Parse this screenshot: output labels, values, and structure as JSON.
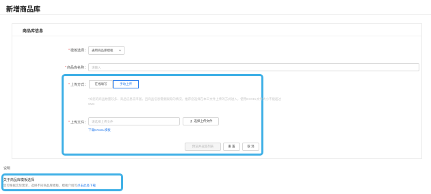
{
  "page": {
    "title": "新增商品库"
  },
  "card": {
    "title": "商品库信息"
  },
  "form": {
    "template": {
      "label": "模板选择：",
      "value": "通用商品库模板"
    },
    "name": {
      "label": "商品库名称：",
      "placeholder": "请输入"
    },
    "upload_method": {
      "label": "上传方式：",
      "options": [
        "在线填写",
        "手动上传"
      ],
      "selected": "手动上传"
    },
    "hint": "*如您的商品数量较多、商品信息较丰富，且商品信息需要跟踪的情况，推荐您选择在本工文件上传的方式进入，使用EXCEL文件大小不能超过5MB",
    "upload_file": {
      "label": "上传文件：",
      "placeholder": "请选择上传文件",
      "button": "选择上传文件",
      "download_link": "下载EXCEL模板"
    },
    "buttons": {
      "preview": "预览并返回列表",
      "reset": "重 置",
      "cancel": "取 消"
    }
  },
  "notes": {
    "section_label": "说明",
    "title": "关于商品库模板选择",
    "text_prefix": "您可根据实际需求，选择不同商品库模板，模板介绍可",
    "text_link": "点击此处下载"
  },
  "colors": {
    "accent": "#2f80ed",
    "highlight": "#3fb0e6",
    "required": "#e94b4b"
  }
}
